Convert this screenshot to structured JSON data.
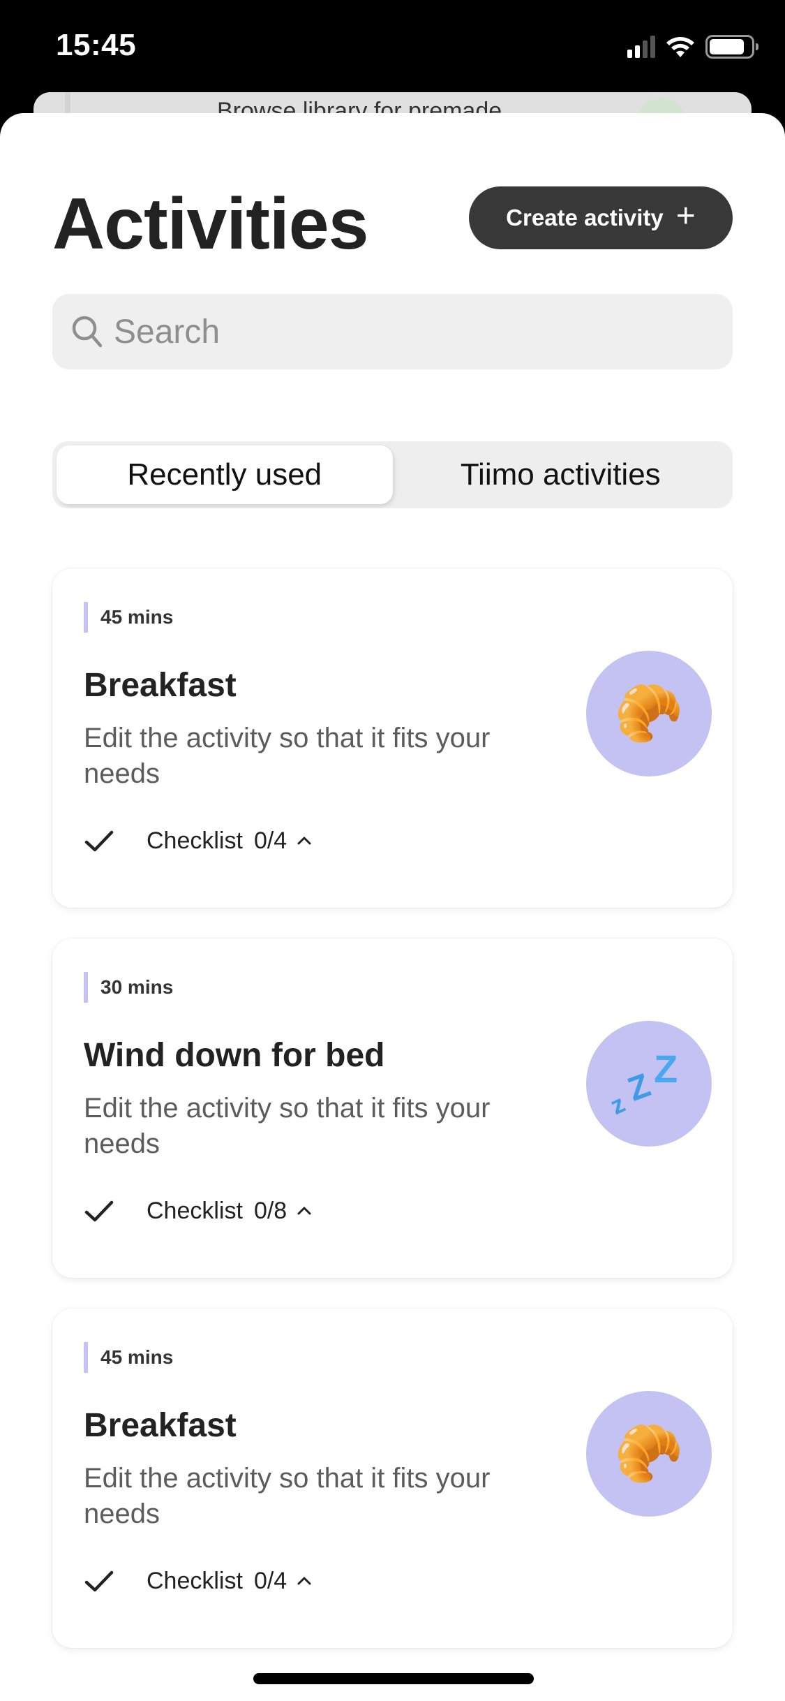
{
  "status_bar": {
    "time": "15:45",
    "icons": [
      "cellular-signal-icon",
      "wifi-icon",
      "battery-icon"
    ]
  },
  "background_sheet": {
    "text": "Browse library for premade"
  },
  "header": {
    "title": "Activities",
    "create_button_label": "Create activity",
    "create_button_icon": "plus-icon"
  },
  "search": {
    "placeholder": "Search",
    "value": "",
    "icon": "search-icon"
  },
  "tabs": [
    {
      "label": "Recently used",
      "active": true
    },
    {
      "label": "Tiimo activities",
      "active": false
    }
  ],
  "colors": {
    "accent": "#c3c2f3",
    "button_dark": "#383838",
    "search_bg": "#efefef"
  },
  "activities": [
    {
      "duration": "45 mins",
      "name": "Breakfast",
      "description": "Edit the activity so that it fits your needs",
      "checklist_label": "Checklist",
      "checklist_count": "0/4",
      "icon": "croissant-icon",
      "emoji": "🥐"
    },
    {
      "duration": "30 mins",
      "name": "Wind down for bed",
      "description": "Edit the activity so that it fits your needs",
      "checklist_label": "Checklist",
      "checklist_count": "0/8",
      "icon": "zzz-sleep-icon",
      "emoji": "💤"
    },
    {
      "duration": "45 mins",
      "name": "Breakfast",
      "description": "Edit the activity so that it fits your needs",
      "checklist_label": "Checklist",
      "checklist_count": "0/4",
      "icon": "croissant-icon",
      "emoji": "🥐"
    }
  ]
}
